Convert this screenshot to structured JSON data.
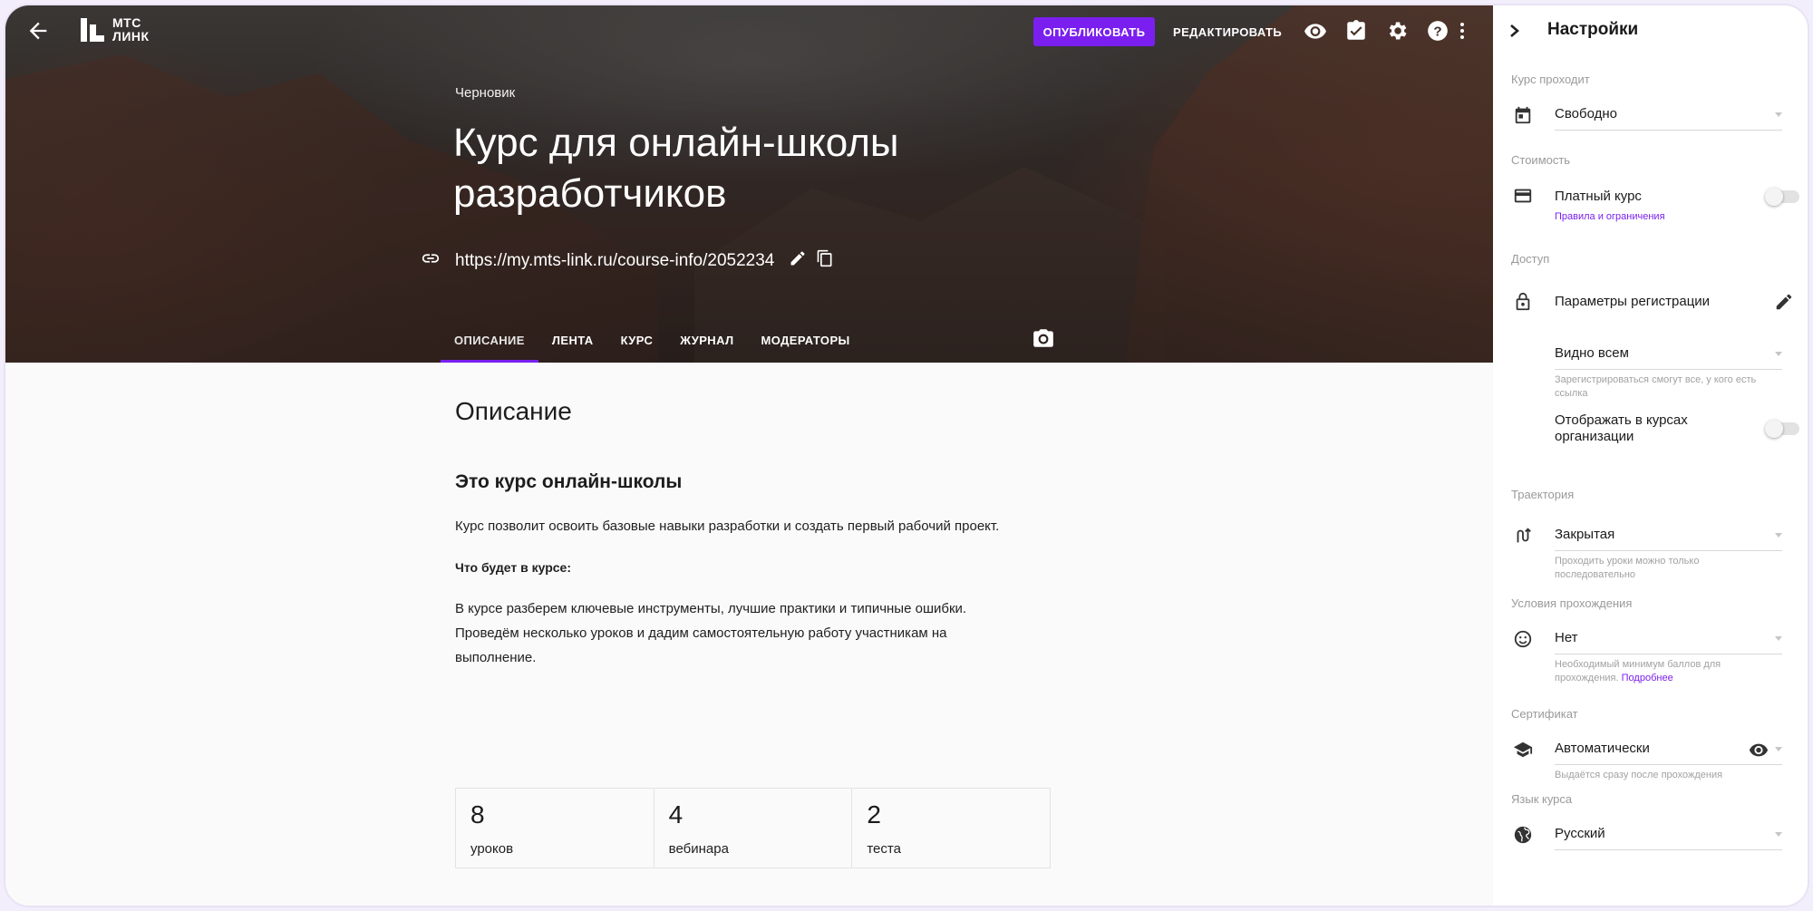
{
  "brand": {
    "logo_line1": "МТС",
    "logo_line2": "ЛИНК"
  },
  "toolbar": {
    "publish_label": "ОПУБЛИКОВАТЬ",
    "edit_label": "РЕДАКТИРОВАТЬ",
    "icons": [
      "eye-icon",
      "checklist-icon",
      "gear-icon",
      "help-icon",
      "more-vert-icon"
    ],
    "accent": "#7a1ff0"
  },
  "course": {
    "status": "Черновик",
    "title": "Курс для онлайн-школы разработчиков",
    "url": "https://my.mts-link.ru/course-info/2052234"
  },
  "tabs": [
    {
      "label": "ОПИСАНИЕ"
    },
    {
      "label": "ЛЕНТА"
    },
    {
      "label": "КУРС"
    },
    {
      "label": "ЖУРНАЛ"
    },
    {
      "label": "МОДЕРАТОРЫ"
    }
  ],
  "description": {
    "heading": "Описание",
    "subheading": "Это курс онлайн-школы",
    "intro": "Курс позволит освоить базовые навыки разработки и создать первый рабочий проект.",
    "bold_label": "Что будет в курсе:",
    "line1": "В курсе разберем ключевые инструменты, лучшие практики и типичные ошибки.",
    "line2": "Проведём несколько уроков и дадим самостоятельную работу участникам на",
    "line3": "выполнение."
  },
  "stats": [
    {
      "value": "8",
      "label": "уроков"
    },
    {
      "value": "4",
      "label": "вебинара"
    },
    {
      "value": "2",
      "label": "теста"
    }
  ],
  "settings": {
    "title": "Настройки",
    "passing_label": "Курс проходит",
    "passing_value": "Свободно",
    "cost_label": "Стоимость",
    "paid_label": "Платный курс",
    "paid_link": "Правила и ограничения",
    "access_label": "Доступ",
    "registration_label": "Параметры регистрации",
    "visibility_value": "Видно всем",
    "visibility_hint": "Зарегистрироваться смогут все, у кого есть ссылка",
    "show_in_org_label": "Отображать в курсах организации",
    "trajectory_label": "Траектория",
    "trajectory_value": "Закрытая",
    "trajectory_hint": "Проходить уроки можно только последовательно",
    "conditions_label": "Условия прохождения",
    "conditions_value": "Нет",
    "conditions_hint": "Необходимый минимум баллов для прохождения.",
    "conditions_link": "Подробнее",
    "certificate_label": "Сертификат",
    "certificate_value": "Автоматически",
    "certificate_hint": "Выдаётся сразу после прохождения",
    "language_label": "Язык курса",
    "language_value": "Русский"
  }
}
